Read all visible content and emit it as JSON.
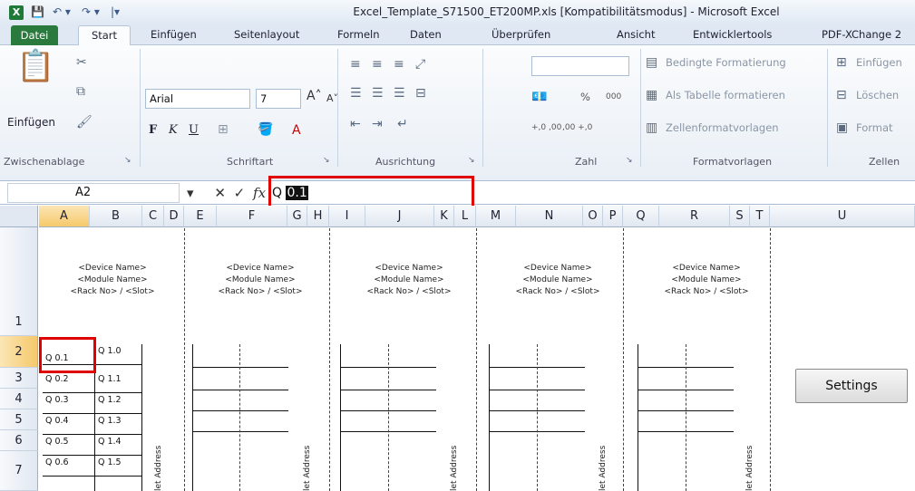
{
  "window": {
    "title": "Excel_Template_S71500_ET200MP.xls  [Kompatibilitätsmodus]  -  Microsoft Excel",
    "app_icon": "X",
    "qa_save": "💾",
    "qa_undo": "↶ ▾",
    "qa_redo": "↷ ▾",
    "qa_customize": "|▾"
  },
  "tabs": {
    "file": "Datei",
    "start": "Start",
    "insert": "Einfügen",
    "layout": "Seitenlayout",
    "formulas": "Formeln",
    "data": "Daten",
    "review": "Überprüfen",
    "view": "Ansicht",
    "dev": "Entwicklertools",
    "pdf": "PDF-XChange 2"
  },
  "ribbon": {
    "clipboard": {
      "paste": "Einfügen",
      "label": "Zwischenablage"
    },
    "font": {
      "name": "Arial",
      "size": "7",
      "bold": "F",
      "italic": "K",
      "underline": "U",
      "label": "Schriftart",
      "grow": "A˄",
      "shrink": "A˅",
      "color": "A"
    },
    "alignment": {
      "label": "Ausrichtung"
    },
    "number": {
      "format": "",
      "percent": "%",
      "thousands": "000",
      "label": "Zahl",
      "inc": "+,0 ,00",
      "dec": ",00 +,0"
    },
    "styles": {
      "conditional": "Bedingte Formatierung",
      "as_table": "Als Tabelle formatieren",
      "cell_styles": "Zellenformatvorlagen",
      "label": "Formatvorlagen"
    },
    "cells": {
      "insert": "Einfügen",
      "delete": "Löschen",
      "format": "Format",
      "label": "Zellen"
    }
  },
  "formula_bar": {
    "name_box": "A2",
    "cancel": "✕",
    "enter": "✓",
    "fx": "fx",
    "value_prefix": "Q ",
    "value_selected": "0.1"
  },
  "columns": [
    "A",
    "B",
    "C",
    "D",
    "E",
    "F",
    "G",
    "H",
    "I",
    "J",
    "K",
    "L",
    "M",
    "N",
    "O",
    "P",
    "Q",
    "R",
    "S",
    "T",
    "U"
  ],
  "rows": [
    "1",
    "2",
    "3",
    "4",
    "5",
    "6",
    "7"
  ],
  "devices": [
    {
      "l1": "<Device Name>",
      "l2": "<Module Name>",
      "l3": "<Rack No> / <Slot>"
    },
    {
      "l1": "<Device Name>",
      "l2": "<Module Name>",
      "l3": "<Rack No> / <Slot>"
    },
    {
      "l1": "<Device Name>",
      "l2": "<Module Name>",
      "l3": "<Rack No> / <Slot>"
    },
    {
      "l1": "<Device Name>",
      "l2": "<Module Name>",
      "l3": "<Rack No> / <Slot>"
    },
    {
      "l1": "<Device Name>",
      "l2": "<Module Name>",
      "l3": "<Rack No> / <Slot>"
    }
  ],
  "q_left": [
    "Q 0.1",
    "Q 0.2",
    "Q 0.3",
    "Q 0.4",
    "Q 0.5",
    "Q 0.6"
  ],
  "q_right": [
    "Q 1.0",
    "Q 1.1",
    "Q 1.2",
    "Q 1.3",
    "Q 1.4",
    "Q 1.5"
  ],
  "rot_label": "let Address",
  "settings_label": "Settings"
}
